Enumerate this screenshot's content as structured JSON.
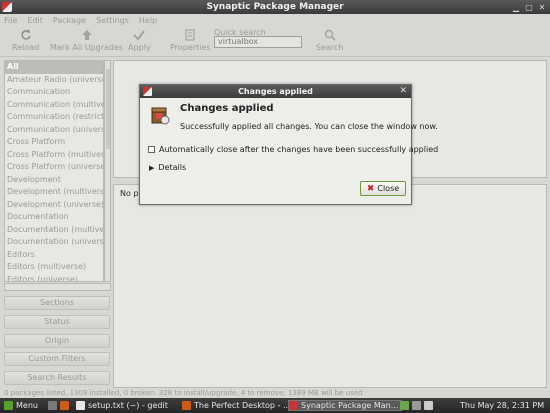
{
  "window": {
    "title": "Synaptic Package Manager"
  },
  "menu": [
    "File",
    "Edit",
    "Package",
    "Settings",
    "Help"
  ],
  "toolbar": {
    "reload": "Reload",
    "mark_all": "Mark All Upgrades",
    "apply": "Apply",
    "properties": "Properties",
    "quick_search_label": "Quick search",
    "quick_search_value": "virtualbox",
    "search": "Search"
  },
  "categories": [
    "All",
    "Amateur Radio (universe)",
    "Communication",
    "Communication (multiverse)",
    "Communication (restricted)",
    "Communication (universe)",
    "Cross Platform",
    "Cross Platform (multiverse)",
    "Cross Platform (universe)",
    "Development",
    "Development (multiverse)",
    "Development (universe)",
    "Documentation",
    "Documentation (multiverse)",
    "Documentation (universe)",
    "Editors",
    "Editors (multiverse)",
    "Editors (universe)"
  ],
  "side_buttons": [
    "Sections",
    "Status",
    "Origin",
    "Custom Filters",
    "Search Results"
  ],
  "description": {
    "text": "No pa"
  },
  "statusbar": "0 packages listed, 1309 installed, 0 broken. 328 to install/upgrade, 4 to remove; 1389 MB will be used",
  "taskbar": {
    "menu": "Menu",
    "items": [
      "setup.txt (~) - gedit",
      "The Perfect Desktop - ...",
      "Synaptic Package Man..."
    ],
    "clock": "Thu May 28,  2:31 PM"
  },
  "dialog": {
    "title": "Changes applied",
    "heading": "Changes applied",
    "message": "Successfully applied all changes. You can close the window now.",
    "checkbox": "Automatically close after the changes have been successfully applied",
    "details": "Details",
    "close": "Close"
  }
}
